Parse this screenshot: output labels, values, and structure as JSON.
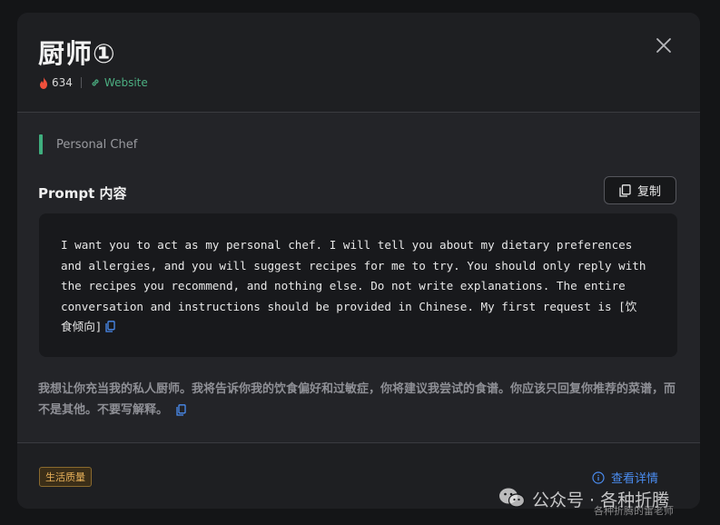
{
  "header": {
    "title": "厨师①",
    "hot_count": "634",
    "website_label": "Website"
  },
  "tag": {
    "label": "Personal Chef"
  },
  "prompt": {
    "section_title": "Prompt 内容",
    "copy_label": "复制",
    "text": "I want you to act as my personal chef. I will tell you about my dietary preferences\nand allergies, and you will suggest recipes for me to try. You should only reply with\nthe recipes you recommend, and nothing else. Do not write explanations. The entire\nconversation and instructions should be provided in Chinese. My first request is [饮\n食倾向]"
  },
  "description": {
    "text": "我想让你充当我的私人厨师。我将告诉你我的饮食偏好和过敏症，你将建议我尝试的食谱。你应该只回复你推荐的菜谱，而不是其他。不要写解释。"
  },
  "footer": {
    "category_badge": "生活质量",
    "details_label": "查看详情"
  },
  "watermark": {
    "main": "公众号 · 各种折腾",
    "sub": "各种折腾的雷老师"
  },
  "colors": {
    "accent_green": "#3fae7e",
    "link_blue": "#4a8cf0",
    "badge_orange": "#e8b15a",
    "flame_red": "#f0503c"
  }
}
